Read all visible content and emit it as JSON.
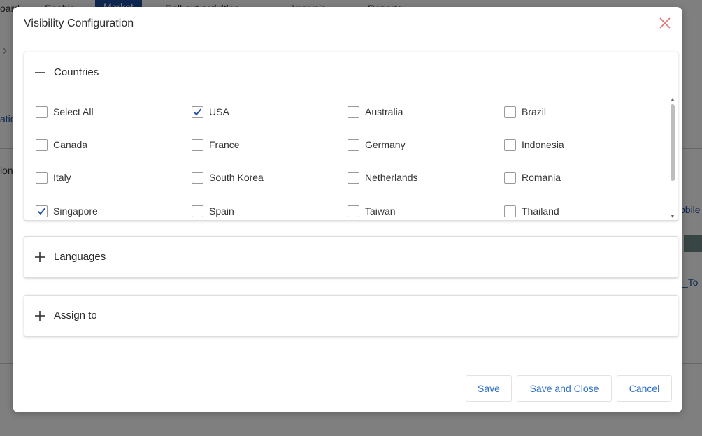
{
  "background": {
    "tabs": [
      "oard",
      "Enable",
      "Market",
      "Roll-out activities",
      "Analysis",
      "Reports"
    ],
    "left_fragments": [
      "atic",
      "ion"
    ],
    "right_fragments": [
      "obile",
      "t_To"
    ]
  },
  "modal": {
    "title": "Visibility Configuration",
    "close_label": "×",
    "countries": {
      "title": "Countries",
      "expanded": true,
      "items": [
        {
          "label": "Select All",
          "checked": false
        },
        {
          "label": "USA",
          "checked": true
        },
        {
          "label": "Australia",
          "checked": false
        },
        {
          "label": "Brazil",
          "checked": false
        },
        {
          "label": "Canada",
          "checked": false
        },
        {
          "label": "France",
          "checked": false
        },
        {
          "label": "Germany",
          "checked": false
        },
        {
          "label": "Indonesia",
          "checked": false
        },
        {
          "label": "Italy",
          "checked": false
        },
        {
          "label": "South Korea",
          "checked": false
        },
        {
          "label": "Netherlands",
          "checked": false
        },
        {
          "label": "Romania",
          "checked": false
        },
        {
          "label": "Singapore",
          "checked": true
        },
        {
          "label": "Spain",
          "checked": false
        },
        {
          "label": "Taiwan",
          "checked": false
        },
        {
          "label": "Thailand",
          "checked": false
        }
      ]
    },
    "languages": {
      "title": "Languages",
      "expanded": false
    },
    "assign_to": {
      "title": "Assign to",
      "expanded": false
    },
    "buttons": {
      "save": "Save",
      "save_and_close": "Save and Close",
      "cancel": "Cancel"
    }
  },
  "colors": {
    "accent": "#2f6fc8",
    "close_icon": "#e07a7a",
    "checkmark": "#1d4fa3"
  }
}
